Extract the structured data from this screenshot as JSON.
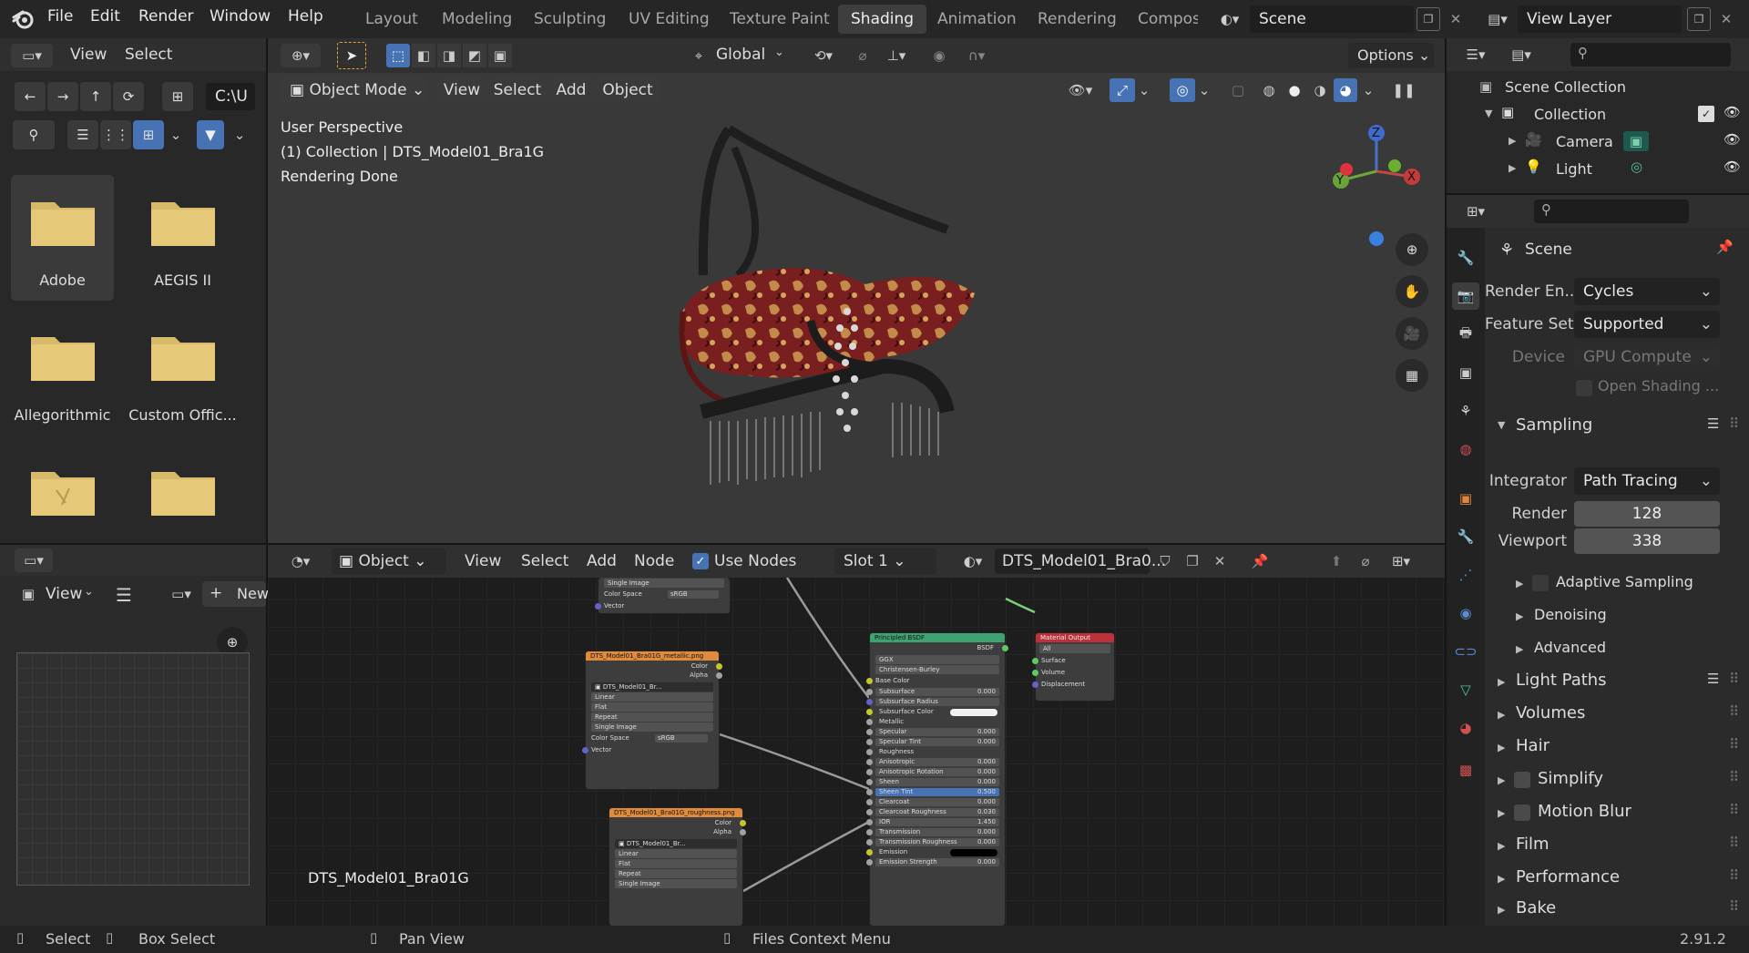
{
  "top_menu": {
    "file": "File",
    "edit": "Edit",
    "render": "Render",
    "window": "Window",
    "help": "Help"
  },
  "workspaces": [
    "Layout",
    "Modeling",
    "Sculpting",
    "UV Editing",
    "Texture Paint",
    "Shading",
    "Animation",
    "Rendering",
    "Compos"
  ],
  "scene_field": "Scene",
  "view_layer_field": "View Layer",
  "file_browser": {
    "header": {
      "view": "View",
      "select": "Select"
    },
    "path": "C:\\U",
    "folders": [
      "Adobe",
      "AEGIS II",
      "Allegorithmic",
      "Custom Offic..."
    ]
  },
  "image_editor": {
    "view": "View",
    "new": "New"
  },
  "viewport": {
    "header": {
      "transform": "Global",
      "options": "Options",
      "mode": "Object Mode",
      "view": "View",
      "select": "Select",
      "add": "Add",
      "object": "Object"
    },
    "overlay": {
      "line1": "User Perspective",
      "line2": "(1) Collection | DTS_Model01_Bra1G",
      "line3": "Rendering Done"
    },
    "gizmo": {
      "z": "Z",
      "y": "Y",
      "x": "X"
    }
  },
  "node_editor": {
    "header": {
      "object": "Object",
      "view": "View",
      "select": "Select",
      "add": "Add",
      "node": "Node",
      "use_nodes": "Use Nodes",
      "slot": "Slot 1",
      "material": "DTS_Model01_Bra0..."
    },
    "material_label": "DTS_Model01_Bra01G",
    "node_top": {
      "rows": [
        "Single Image",
        "Color Space",
        "Vector"
      ],
      "color_space": "sRGB"
    },
    "node_metallic": {
      "title": "DTS_Model01_Bra01G_metallic.png",
      "out": [
        "Color",
        "Alpha"
      ],
      "img": "DTS_Model01_Br...",
      "rows": [
        "Linear",
        "Flat",
        "Repeat",
        "Single Image"
      ],
      "color_space_label": "Color Space",
      "color_space": "sRGB",
      "vector": "Vector"
    },
    "node_roughness": {
      "title": "DTS_Model01_Bra01G_roughness.png",
      "out": [
        "Color",
        "Alpha"
      ],
      "img": "DTS_Model01_Br...",
      "rows": [
        "Linear",
        "Flat",
        "Repeat",
        "Single Image"
      ]
    },
    "node_bsdf": {
      "title": "Principled BSDF",
      "out": "BSDF",
      "dist": "GGX",
      "sss": "Christensen-Burley",
      "base_color": "Base Color",
      "rows": [
        [
          "Subsurface",
          "0.000"
        ],
        [
          "Subsurface Radius",
          ""
        ],
        [
          "Subsurface Color",
          ""
        ],
        [
          "Metallic",
          ""
        ],
        [
          "Specular",
          "0.000"
        ],
        [
          "Specular Tint",
          "0.000"
        ],
        [
          "Roughness",
          ""
        ],
        [
          "Anisotropic",
          "0.000"
        ],
        [
          "Anisotropic Rotation",
          "0.000"
        ],
        [
          "Sheen",
          "0.000"
        ],
        [
          "Sheen Tint",
          "0.500"
        ],
        [
          "Clearcoat",
          "0.000"
        ],
        [
          "Clearcoat Roughness",
          "0.030"
        ],
        [
          "IOR",
          "1.450"
        ],
        [
          "Transmission",
          "0.000"
        ],
        [
          "Transmission Roughness",
          "0.000"
        ],
        [
          "Emission",
          ""
        ],
        [
          "Emission Strength",
          "0.000"
        ]
      ]
    },
    "node_output": {
      "title": "Material Output",
      "target": "All",
      "inputs": [
        "Surface",
        "Volume",
        "Displacement"
      ]
    }
  },
  "outliner": {
    "scene_collection": "Scene Collection",
    "collection": "Collection",
    "camera": "Camera",
    "light": "Light"
  },
  "properties": {
    "title": "Scene",
    "render_engine_label": "Render En...",
    "render_engine": "Cycles",
    "feature_set_label": "Feature Set",
    "feature_set": "Supported",
    "device_label": "Device",
    "device": "GPU Compute",
    "open_shading": "Open Shading ...",
    "sampling": "Sampling",
    "integrator_label": "Integrator",
    "integrator": "Path Tracing",
    "render_label": "Render",
    "render_value": "128",
    "viewport_label": "Viewport",
    "viewport_value": "338",
    "adaptive": "Adaptive Sampling",
    "denoising": "Denoising",
    "advanced": "Advanced",
    "light_paths": "Light Paths",
    "volumes": "Volumes",
    "hair": "Hair",
    "simplify": "Simplify",
    "motion_blur": "Motion Blur",
    "film": "Film",
    "performance": "Performance",
    "bake": "Bake"
  },
  "status_bar": {
    "select": "Select",
    "box_select": "Box Select",
    "pan_view": "Pan View",
    "context_menu": "Files Context Menu",
    "version": "2.91.2"
  },
  "colors": {
    "accent": "#4772b3",
    "background": "#161616",
    "panel": "#2b2b2b"
  }
}
